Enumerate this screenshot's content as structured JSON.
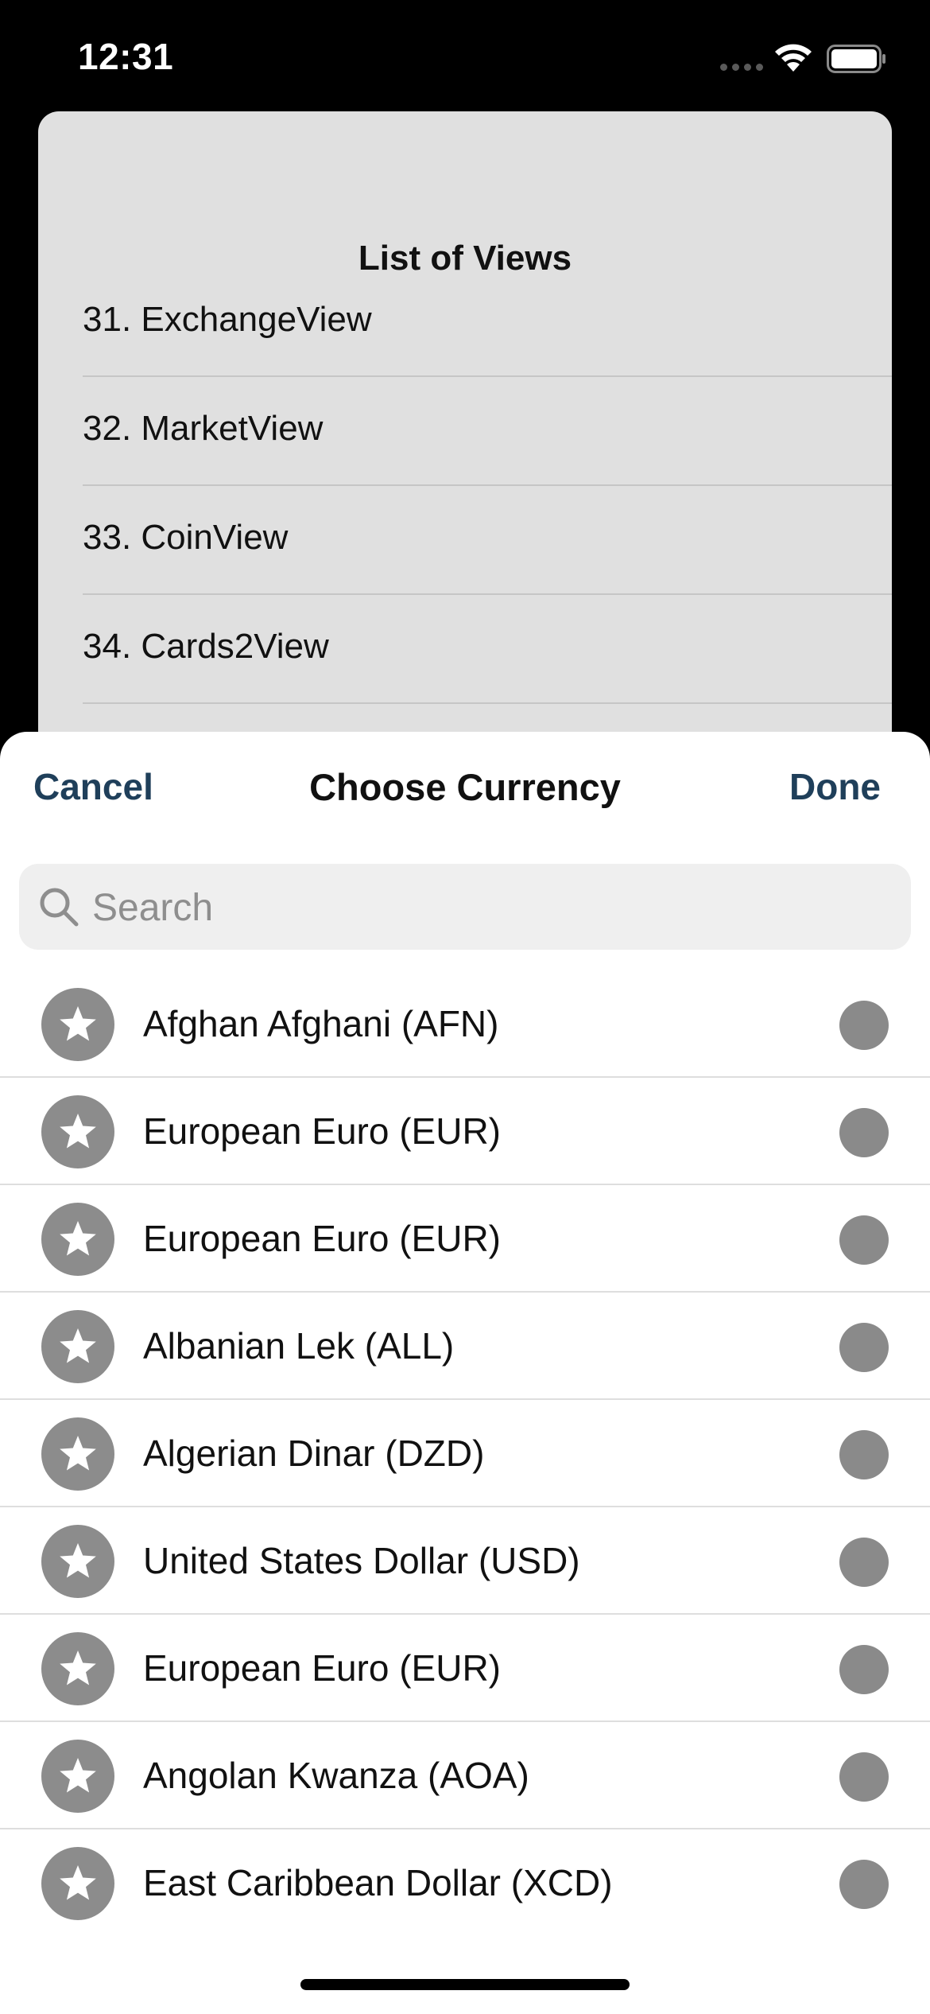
{
  "status_bar": {
    "time": "12:31"
  },
  "background": {
    "title": "List of Views",
    "items": [
      "31. ExchangeView",
      "32. MarketView",
      "33. CoinView",
      "34. Cards2View"
    ]
  },
  "sheet": {
    "cancel_label": "Cancel",
    "title": "Choose Currency",
    "done_label": "Done",
    "search_placeholder": "Search",
    "currencies": [
      "Afghan Afghani (AFN)",
      "European Euro (EUR)",
      "European Euro (EUR)",
      "Albanian Lek (ALL)",
      "Algerian Dinar (DZD)",
      "United States Dollar (USD)",
      "European Euro (EUR)",
      "Angolan Kwanza (AOA)",
      "East Caribbean Dollar (XCD)"
    ]
  },
  "colors": {
    "accent": "#1f3f5a",
    "icon_gray": "#8c8c8c",
    "search_bg": "#efefef"
  },
  "icons": [
    "wifi-icon",
    "battery-icon",
    "search-icon",
    "star-icon"
  ]
}
